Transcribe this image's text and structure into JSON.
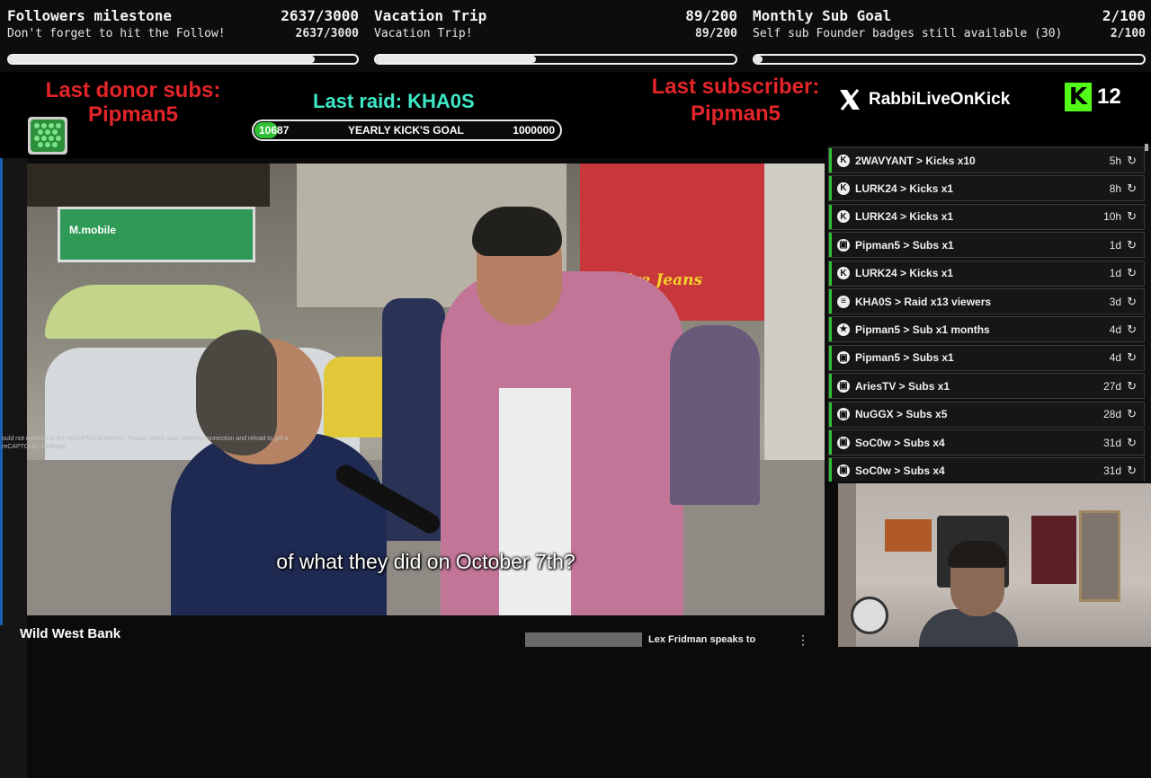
{
  "goals": [
    {
      "title": "Followers milestone",
      "count": "2637/3000",
      "subtitle": "Don't forget to hit the Follow!",
      "count2": "2637/3000",
      "progress": 0.879
    },
    {
      "title": "Vacation Trip",
      "count": "89/200",
      "subtitle": "Vacation Trip!",
      "count2": "89/200",
      "progress": 0.445
    },
    {
      "title": "Monthly Sub Goal",
      "count": "2/100",
      "subtitle": "Self sub Founder badges still available (30)",
      "count2": "2/100",
      "progress": 0.02
    }
  ],
  "banner": {
    "last_donor_label": "Last donor subs:",
    "last_donor_name": "Pipman5",
    "last_raid": "Last raid: KHA0S",
    "yearly_goal_current": "10687",
    "yearly_goal_label": "YEARLY KICK'S GOAL",
    "yearly_goal_target": "1000000",
    "last_subscriber_label": "Last subscriber:",
    "last_subscriber_name": "Pipman5",
    "x_handle": "RabbiLiveOnKick",
    "kick_count": "12"
  },
  "events": [
    {
      "icon": "kick-icon",
      "text": "2WAVYANT > Kicks x10",
      "age": "5h"
    },
    {
      "icon": "kick-icon",
      "text": "LURK24 > Kicks x1",
      "age": "8h"
    },
    {
      "icon": "kick-icon",
      "text": "LURK24 > Kicks x1",
      "age": "10h"
    },
    {
      "icon": "gift-icon",
      "text": "Pipman5 > Subs x1",
      "age": "1d"
    },
    {
      "icon": "kick-icon",
      "text": "LURK24 > Kicks x1",
      "age": "1d"
    },
    {
      "icon": "raid-icon",
      "text": "KHA0S > Raid x13 viewers",
      "age": "3d"
    },
    {
      "icon": "star-icon",
      "text": "Pipman5 > Sub x1 months",
      "age": "4d"
    },
    {
      "icon": "gift-icon",
      "text": "Pipman5 > Subs x1",
      "age": "4d"
    },
    {
      "icon": "gift-icon",
      "text": "AriesTV > Subs x1",
      "age": "27d"
    },
    {
      "icon": "gift-icon",
      "text": "NuGGX > Subs x5",
      "age": "28d"
    },
    {
      "icon": "gift-icon",
      "text": "SoC0w > Subs x4",
      "age": "31d"
    },
    {
      "icon": "gift-icon",
      "text": "SoC0w > Subs x4",
      "age": "31d"
    }
  ],
  "video": {
    "caption": "of what they did on October 7th?",
    "recaptcha_text": "ould not connect to the reCAPTCHA service. Please check your internet connection and reload to get a reCAPTCHA challenge.",
    "title": "Wild West Bank",
    "related_title": "Lex Fridman speaks to",
    "shop_sign": "Fire Jeans",
    "mobile_sign": "M.mobile"
  }
}
